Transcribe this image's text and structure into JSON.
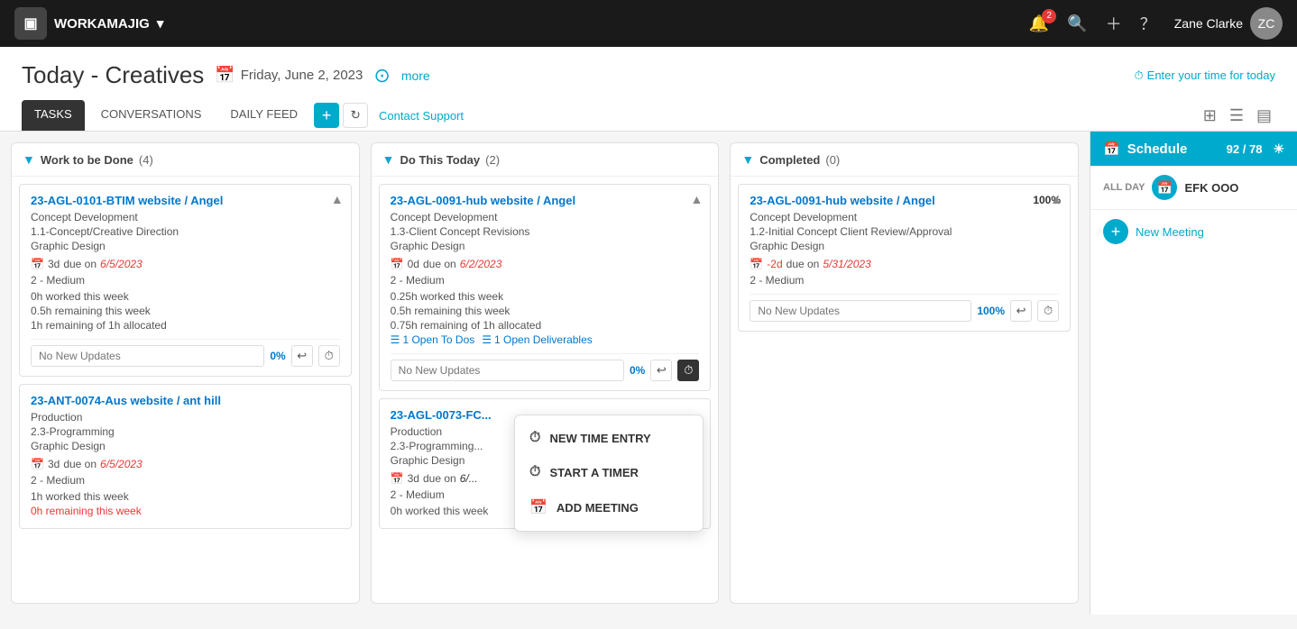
{
  "header": {
    "logo_icon": "▣",
    "app_name": "WORKAMAJIG",
    "notification_badge": "2",
    "user_name": "Zane Clarke",
    "avatar_initials": "ZC"
  },
  "page": {
    "title": "Today - Creatives",
    "date": "Friday, June 2, 2023",
    "more_label": "more",
    "enter_time_label": "Enter your time for today"
  },
  "tabs": {
    "tasks_label": "TASKS",
    "conversations_label": "CONVERSATIONS",
    "daily_feed_label": "DAILY FEED",
    "contact_support_label": "Contact Support"
  },
  "columns": {
    "work_to_do": {
      "header": "Work to be Done",
      "count": "(4)"
    },
    "do_today": {
      "header": "Do This Today",
      "count": "(2)"
    },
    "completed": {
      "header": "Completed",
      "count": "(0)"
    }
  },
  "tasks_col1": [
    {
      "id": "card1",
      "title": "23-AGL-0101-BTIM website / Angel",
      "sub1": "Concept Development",
      "sub2": "1.1-Concept/Creative Direction",
      "dept": "Graphic Design",
      "duration": "3d",
      "due_label": "due on",
      "due_date": "6/5/2023",
      "due_class": "normal",
      "priority": "2 - Medium",
      "worked": "0h worked this week",
      "remaining": "0.5h remaining this week",
      "allocated": "1h remaining of 1h allocated",
      "placeholder": "No New Updates",
      "pct": "0%"
    },
    {
      "id": "card2",
      "title": "23-ANT-0074-Aus website / ant hill",
      "sub1": "Production",
      "sub2": "2.3-Programming",
      "dept": "Graphic Design",
      "duration": "3d",
      "due_label": "due on",
      "due_date": "6/5/2023",
      "due_class": "normal",
      "priority": "2 - Medium",
      "worked": "1h worked this week",
      "remaining": "0h remaining this week",
      "allocated": "",
      "placeholder": "",
      "pct": ""
    }
  ],
  "tasks_col2": [
    {
      "id": "card3",
      "title": "23-AGL-0091-hub website / Angel",
      "sub1": "Concept Development",
      "sub2": "1.3-Client Concept Revisions",
      "dept": "Graphic Design",
      "duration": "0d",
      "due_label": "due on",
      "due_date": "6/2/2023",
      "due_class": "urgent",
      "priority": "2 - Medium",
      "worked": "0.25h worked this week",
      "remaining": "0.5h remaining this week",
      "allocated": "0.75h remaining of 1h allocated",
      "open_todos": "1 Open To Dos",
      "open_deliverables": "1 Open Deliverables",
      "placeholder": "No New Updates",
      "pct": "0%"
    },
    {
      "id": "card4",
      "title": "23-AGL-0073-FC...",
      "sub1": "Production",
      "sub2": "2.3-Programming...",
      "dept": "Graphic Design",
      "duration": "3d",
      "due_label": "due on",
      "due_date": "6/...",
      "due_class": "normal",
      "priority": "2 - Medium",
      "worked": "0h worked this week",
      "allocated": "",
      "placeholder": "",
      "pct": ""
    }
  ],
  "tasks_col3": [
    {
      "id": "card5",
      "title": "23-AGL-0091-hub website / Angel",
      "sub1": "Concept Development",
      "sub2": "1.2-Initial Concept Client Review/Approval",
      "dept": "Graphic Design",
      "duration": "-2d",
      "due_label": "due on",
      "due_date": "5/31/2023",
      "due_class": "overdue",
      "priority": "2 - Medium",
      "placeholder": "No New Updates",
      "pct": "100%",
      "pct_badge": "100%"
    }
  ],
  "schedule": {
    "title": "Schedule",
    "score": "92 / 78",
    "allday_label": "ALL DAY",
    "allday_item": "EFK OOO",
    "new_meeting_label": "New Meeting"
  },
  "context_menu": {
    "items": [
      {
        "icon": "⏱",
        "label": "NEW TIME ENTRY"
      },
      {
        "icon": "⏱",
        "label": "START A TIMER"
      },
      {
        "icon": "📅",
        "label": "ADD MEETING"
      }
    ]
  }
}
